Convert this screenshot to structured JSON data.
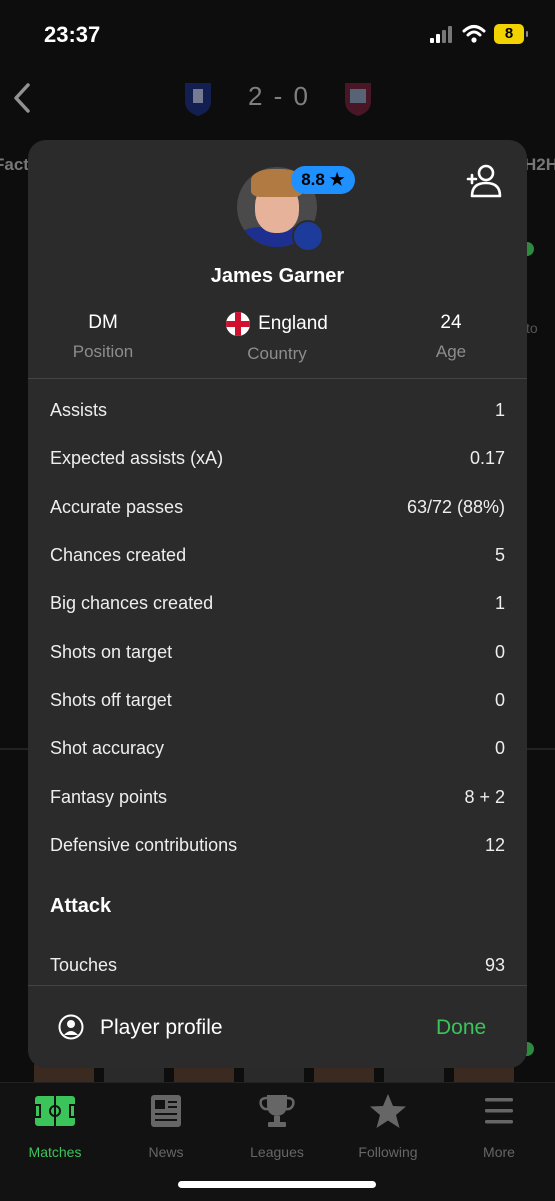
{
  "status_bar": {
    "time": "23:37",
    "battery": "8"
  },
  "match": {
    "score": "2 - 0",
    "bg_tab_left": "Fact",
    "bg_tab_right": "H2H",
    "bg_text": "to"
  },
  "player": {
    "rating": "8.8 ★",
    "name": "James Garner",
    "position_value": "DM",
    "position_label": "Position",
    "country_value": "England",
    "country_label": "Country",
    "age_value": "24",
    "age_label": "Age"
  },
  "stats": [
    {
      "label": "Assists",
      "value": "1"
    },
    {
      "label": "Expected assists (xA)",
      "value": "0.17"
    },
    {
      "label": "Accurate passes",
      "value": "63/72 (88%)"
    },
    {
      "label": "Chances created",
      "value": "5"
    },
    {
      "label": "Big chances created",
      "value": "1"
    },
    {
      "label": "Shots on target",
      "value": "0"
    },
    {
      "label": "Shots off target",
      "value": "0"
    },
    {
      "label": "Shot accuracy",
      "value": "0"
    },
    {
      "label": "Fantasy points",
      "value": "8 + 2"
    },
    {
      "label": "Defensive contributions",
      "value": "12"
    }
  ],
  "attack": {
    "title": "Attack",
    "stats": [
      {
        "label": "Touches",
        "value": "93"
      }
    ]
  },
  "footer": {
    "profile_label": "Player profile",
    "done_label": "Done"
  },
  "tabbar": [
    {
      "label": "Matches",
      "icon": "pitch-icon"
    },
    {
      "label": "News",
      "icon": "news-icon"
    },
    {
      "label": "Leagues",
      "icon": "trophy-icon"
    },
    {
      "label": "Following",
      "icon": "star-icon"
    },
    {
      "label": "More",
      "icon": "menu-icon"
    }
  ],
  "colors": {
    "accent": "#3ac45a",
    "rating": "#1e90ff",
    "modal_bg": "#2b2b2b",
    "battery": "#f2d300"
  }
}
